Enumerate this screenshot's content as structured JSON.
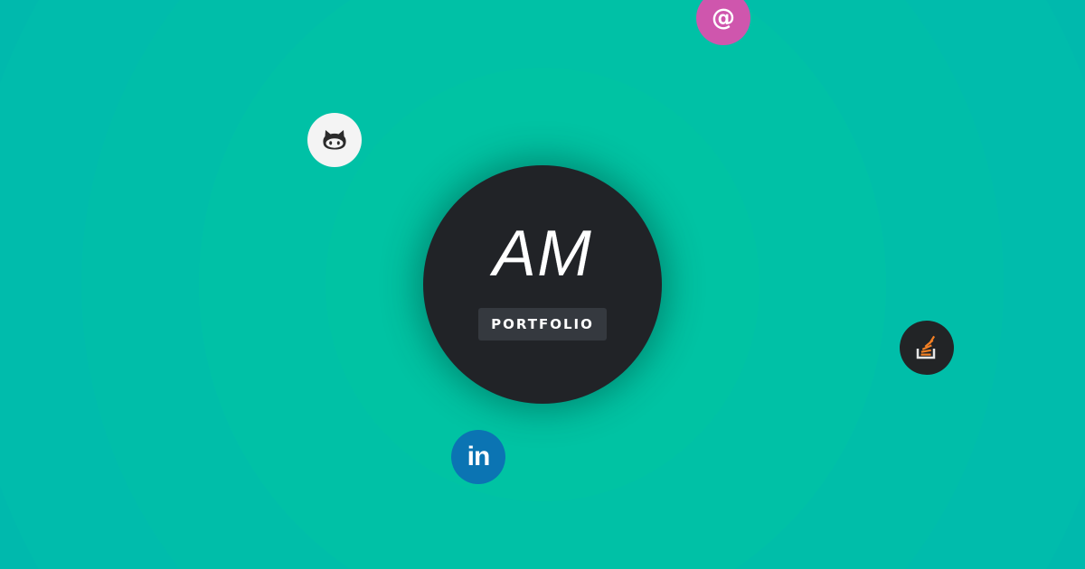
{
  "logo": {
    "monogram": "AM",
    "button_label": "PORTFOLIO"
  },
  "social_links": [
    {
      "name": "email",
      "icon": "at-sign-icon",
      "glyph": "@",
      "color": "#cf56ad"
    },
    {
      "name": "github",
      "icon": "github-octocat-icon",
      "color": "#f4f4f4"
    },
    {
      "name": "stackoverflow",
      "icon": "stackoverflow-icon",
      "color": "#222426"
    },
    {
      "name": "linkedin",
      "icon": "linkedin-icon",
      "glyph": "in",
      "color": "#0b74b3"
    }
  ],
  "theme": {
    "background": "#00c2a0",
    "circle": "#212327",
    "button": "#35393f"
  }
}
